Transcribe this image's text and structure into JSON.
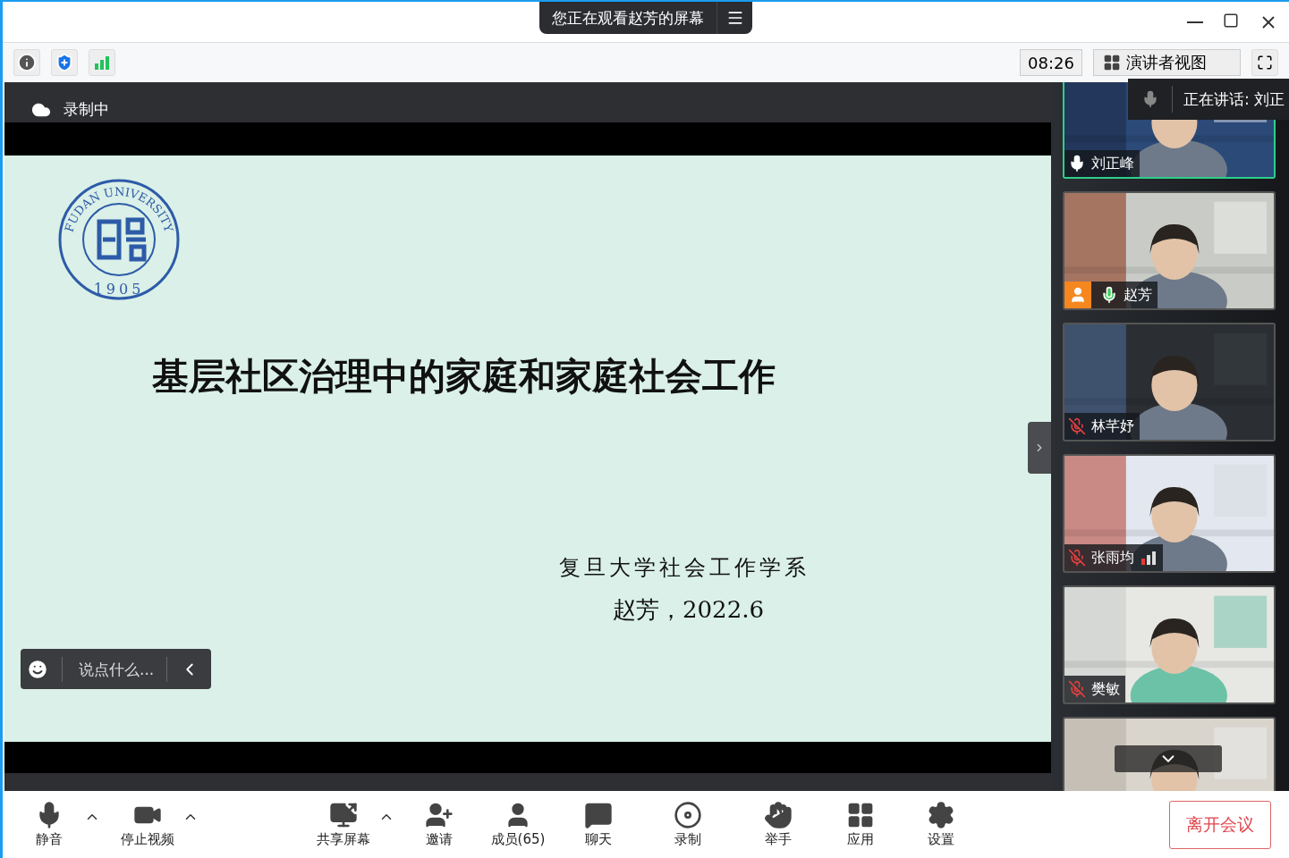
{
  "title_bar": {
    "banner": "您正在观看赵芳的屏幕"
  },
  "toolbar": {
    "timer": "08:26",
    "view_mode": "演讲者视图"
  },
  "speaking_popup": {
    "text": "正在讲话: 刘正"
  },
  "recording": {
    "label": "录制中"
  },
  "slide": {
    "logo": {
      "arc_text": "FUDAN UNIVERSITY",
      "year": "1905"
    },
    "title": "基层社区治理中的家庭和家庭社会工作",
    "department": "复旦大学社会工作学系",
    "author_date": "赵芳，2022.6"
  },
  "chat_box": {
    "placeholder": "说点什么..."
  },
  "participants": [
    {
      "name": "刘正峰",
      "muted": false,
      "speaking": false,
      "host": false,
      "active_speaker": true,
      "weak_signal": false
    },
    {
      "name": "赵芳",
      "muted": false,
      "speaking": true,
      "host": true,
      "active_speaker": false,
      "weak_signal": false
    },
    {
      "name": "林芊妤",
      "muted": true,
      "speaking": false,
      "host": false,
      "active_speaker": false,
      "weak_signal": false
    },
    {
      "name": "张雨均",
      "muted": true,
      "speaking": false,
      "host": false,
      "active_speaker": false,
      "weak_signal": true
    },
    {
      "name": "樊敏",
      "muted": true,
      "speaking": false,
      "host": false,
      "active_speaker": false,
      "weak_signal": false
    }
  ],
  "controls": [
    {
      "kind": "mic",
      "label": "静音",
      "caret": true
    },
    {
      "kind": "video",
      "label": "停止视频",
      "caret": true
    },
    {
      "kind": "share",
      "label": "共享屏幕",
      "caret": true
    },
    {
      "kind": "invite",
      "label": "邀请",
      "caret": false
    },
    {
      "kind": "members",
      "label": "成员(65)",
      "caret": false
    },
    {
      "kind": "chat",
      "label": "聊天",
      "caret": false
    },
    {
      "kind": "record",
      "label": "录制",
      "caret": false
    },
    {
      "kind": "hand",
      "label": "举手",
      "caret": false
    },
    {
      "kind": "apps",
      "label": "应用",
      "caret": false
    },
    {
      "kind": "settings",
      "label": "设置",
      "caret": false
    }
  ],
  "leave_button": "离开会议"
}
